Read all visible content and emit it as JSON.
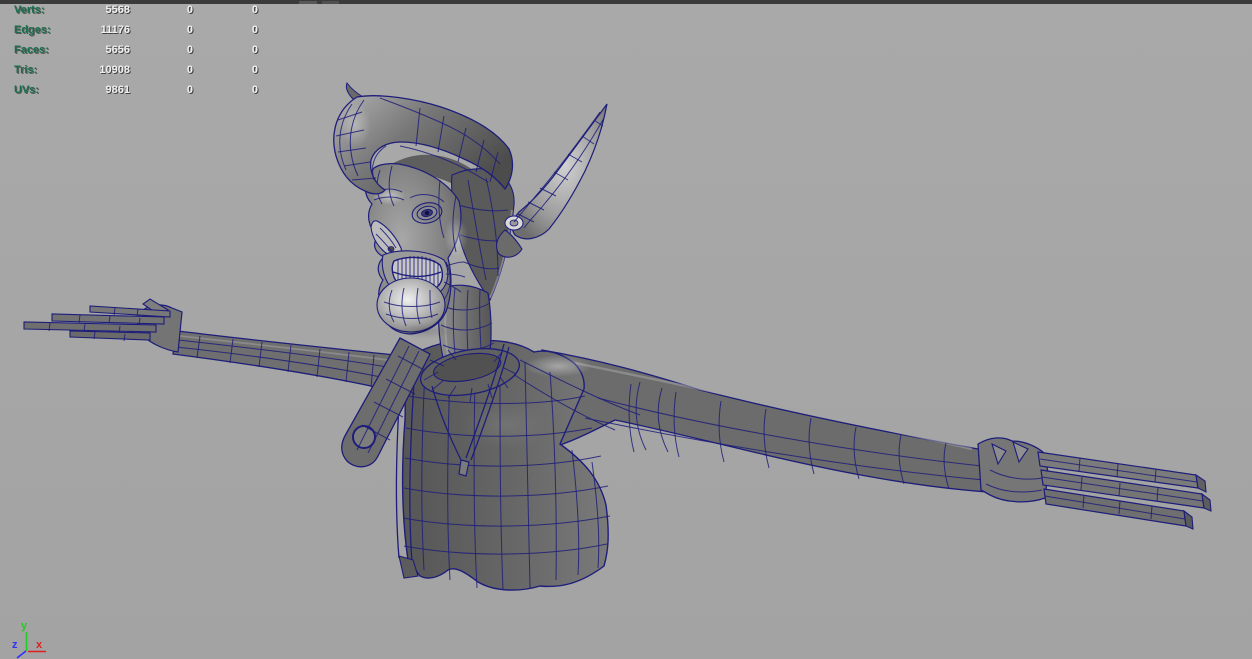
{
  "window": {
    "app_area": "3d-viewport"
  },
  "poly_count_hud": {
    "rows": [
      {
        "label": "Verts:",
        "values": [
          "5568",
          "0",
          "0"
        ]
      },
      {
        "label": "Edges:",
        "values": [
          "11176",
          "0",
          "0"
        ]
      },
      {
        "label": "Faces:",
        "values": [
          "5656",
          "0",
          "0"
        ]
      },
      {
        "label": "Tris:",
        "values": [
          "10908",
          "0",
          "0"
        ]
      },
      {
        "label": "UVs:",
        "values": [
          "9861",
          "0",
          "0"
        ]
      }
    ]
  },
  "axis_gizmo": {
    "x": {
      "label": "x",
      "color": "#e02020"
    },
    "y": {
      "label": "y",
      "color": "#22cc22"
    },
    "z": {
      "label": "z",
      "color": "#3030ff"
    }
  },
  "colors": {
    "background": "#a7a7a7",
    "top_bar": "#3b3b3b",
    "wireframe": "#1d1d7a",
    "hud_label_green": "#1a6e4e",
    "hud_value_white": "#f0f0f0",
    "surface_gray": "#6e6e6e"
  }
}
